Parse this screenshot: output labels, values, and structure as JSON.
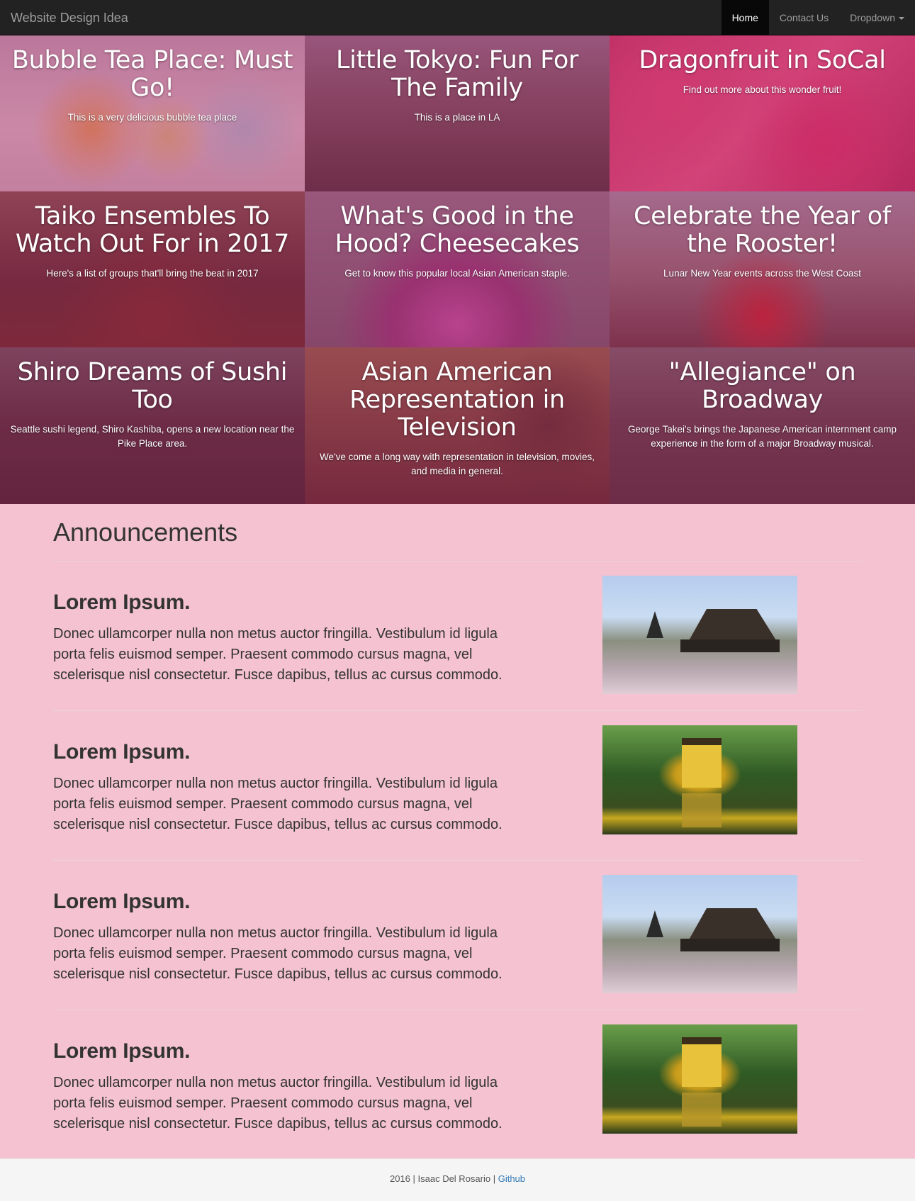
{
  "navbar": {
    "brand": "Website Design Idea",
    "items": [
      {
        "label": "Home"
      },
      {
        "label": "Contact Us"
      },
      {
        "label": "Dropdown"
      }
    ]
  },
  "tiles": [
    {
      "title": "Bubble Tea Place: Must Go!",
      "text": "This is a very delicious bubble tea place"
    },
    {
      "title": "Little Tokyo: Fun For The Family",
      "text": "This is a place in LA"
    },
    {
      "title": "Dragonfruit in SoCal",
      "text": "Find out more about this wonder fruit!"
    },
    {
      "title": "Taiko Ensembles To Watch Out For in 2017",
      "text": "Here's a list of groups that'll bring the beat in 2017"
    },
    {
      "title": "What's Good in the Hood? Cheesecakes",
      "text": "Get to know this popular local Asian American staple."
    },
    {
      "title": "Celebrate the Year of the Rooster!",
      "text": "Lunar New Year events across the West Coast"
    },
    {
      "title": "Shiro Dreams of Sushi Too",
      "text": "Seattle sushi legend, Shiro Kashiba, opens a new location near the Pike Place area."
    },
    {
      "title": "Asian American Representation in Television",
      "text": "We've come a long way with representation in television, movies, and media in general."
    },
    {
      "title": "\"Allegiance\" on Broadway",
      "text": "George Takei's brings the Japanese American internment camp experience in the form of a major Broadway musical."
    }
  ],
  "announcements": {
    "heading": "Announcements",
    "items": [
      {
        "title": "Lorem Ipsum.",
        "body": "Donec ullamcorper nulla non metus auctor fringilla. Vestibulum id ligula porta felis euismod semper. Praesent commodo cursus magna, vel scelerisque nisl consectetur. Fusce dapibus, tellus ac cursus commodo."
      },
      {
        "title": "Lorem Ipsum.",
        "body": "Donec ullamcorper nulla non metus auctor fringilla. Vestibulum id ligula porta felis euismod semper. Praesent commodo cursus magna, vel scelerisque nisl consectetur. Fusce dapibus, tellus ac cursus commodo."
      },
      {
        "title": "Lorem Ipsum.",
        "body": "Donec ullamcorper nulla non metus auctor fringilla. Vestibulum id ligula porta felis euismod semper. Praesent commodo cursus magna, vel scelerisque nisl consectetur. Fusce dapibus, tellus ac cursus commodo."
      },
      {
        "title": "Lorem Ipsum.",
        "body": "Donec ullamcorper nulla non metus auctor fringilla. Vestibulum id ligula porta felis euismod semper. Praesent commodo cursus magna, vel scelerisque nisl consectetur. Fusce dapibus, tellus ac cursus commodo."
      }
    ]
  },
  "footer": {
    "text": "2016 | Isaac Del Rosario | ",
    "link": "Github"
  },
  "colors": {
    "navbar_bg": "#222222",
    "page_bg": "#f4c2d1",
    "tile_tint": "#aa2864",
    "link": "#337ab7"
  }
}
